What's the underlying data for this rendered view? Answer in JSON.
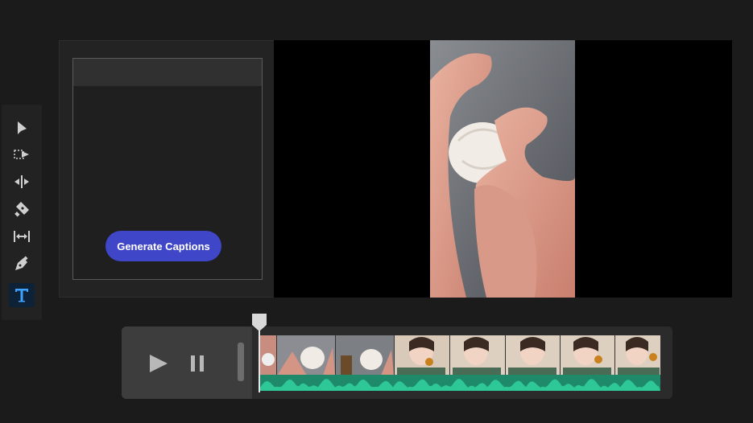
{
  "toolbar": {
    "tools": [
      {
        "icon": "selection-arrow-icon"
      },
      {
        "icon": "track-select-forward-icon"
      },
      {
        "icon": "ripple-edit-icon"
      },
      {
        "icon": "razor-icon"
      },
      {
        "icon": "slip-icon"
      },
      {
        "icon": "pen-icon"
      },
      {
        "icon": "type-tool-icon",
        "active": true
      }
    ]
  },
  "captions": {
    "generate_label": "Generate Captions"
  },
  "colors": {
    "accent_button": "#4046c8",
    "active_tool": "#0d2236",
    "audio_waveform": "#2ec896"
  }
}
